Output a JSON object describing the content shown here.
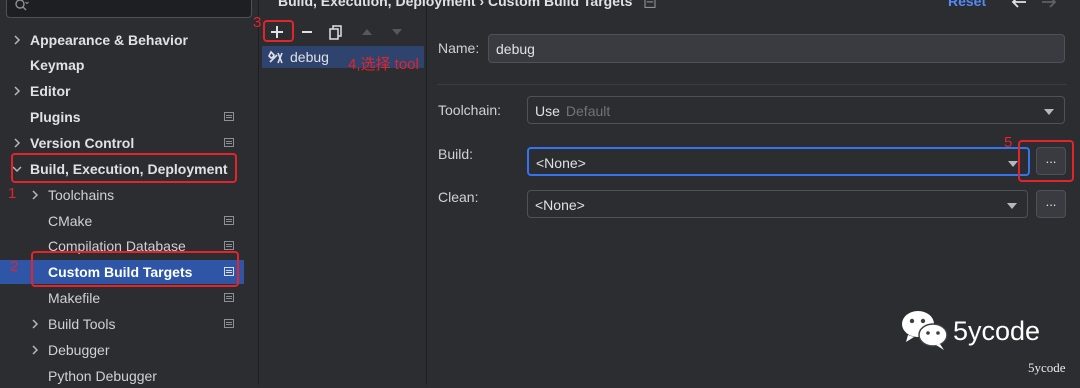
{
  "sidebar": {
    "search_placeholder": "",
    "items": [
      {
        "label": "Appearance & Behavior"
      },
      {
        "label": "Keymap"
      },
      {
        "label": "Editor"
      },
      {
        "label": "Plugins"
      },
      {
        "label": "Version Control"
      },
      {
        "label": "Build, Execution, Deployment"
      },
      {
        "label": "Toolchains"
      },
      {
        "label": "CMake"
      },
      {
        "label": "Compilation Database"
      },
      {
        "label": "Custom Build Targets"
      },
      {
        "label": "Makefile"
      },
      {
        "label": "Build Tools"
      },
      {
        "label": "Debugger"
      },
      {
        "label": "Python Debugger"
      }
    ]
  },
  "header": {
    "breadcrumb": "Build, Execution, Deployment  ›  Custom Build Targets",
    "reset_label": "Reset"
  },
  "targets": {
    "items": [
      {
        "label": "debug"
      }
    ]
  },
  "form": {
    "name_label": "Name:",
    "name_value": "debug",
    "toolchain_label": "Toolchain:",
    "toolchain_value": "Use",
    "toolchain_hint": "Default",
    "build_label": "Build:",
    "build_value": "<None>",
    "clean_label": "Clean:",
    "clean_value": "<None>",
    "browse_label": "..."
  },
  "annotations": {
    "n1": "1",
    "n2": "2",
    "n3": "3",
    "n4": "4,选择 tool",
    "n5": "5"
  },
  "watermark": {
    "brand": "5ycode",
    "small": "5ycode"
  },
  "colors": {
    "background": "#2b2d30",
    "selection": "#2e55a6",
    "accent_link": "#548af7",
    "annotation": "#e3242b"
  }
}
